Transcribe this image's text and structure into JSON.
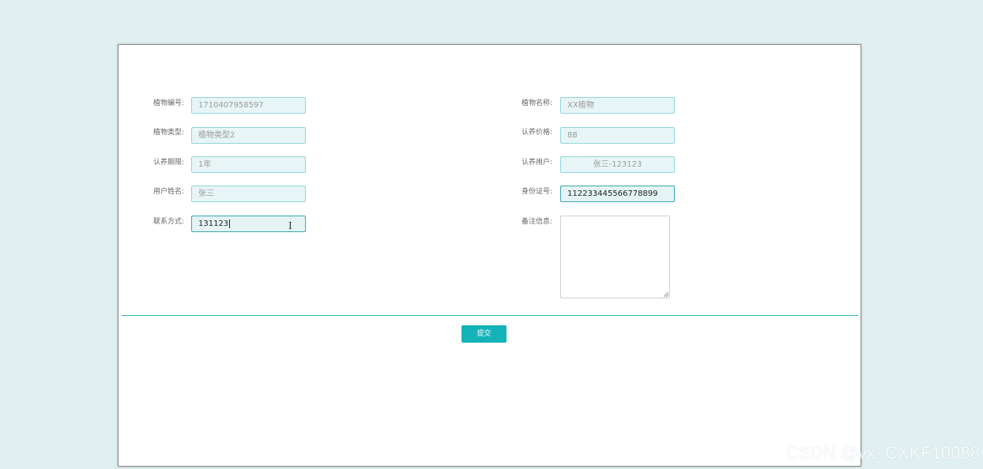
{
  "form": {
    "left": [
      {
        "label": "植物编号:",
        "value": "1710407958597"
      },
      {
        "label": "植物类型:",
        "value": "植物类型2"
      },
      {
        "label": "认养期限:",
        "value": "1年"
      },
      {
        "label": "用户姓名:",
        "value": "张三"
      },
      {
        "label": "联系方式:",
        "value": "131123"
      }
    ],
    "right": [
      {
        "label": "植物名称:",
        "value": "XX植物"
      },
      {
        "label": "认养价格:",
        "value": "88"
      },
      {
        "label": "认养用户:",
        "value": "张三-123123"
      },
      {
        "label": "身份证号:",
        "value": "112233445566778899"
      },
      {
        "label": "备注信息:",
        "value": ""
      }
    ]
  },
  "actions": {
    "submit_label": "提交"
  },
  "watermark": "CSDN @vx_CXKF10088",
  "colors": {
    "background": "#e0eff0",
    "accent": "#14b3b9",
    "input_border": "#8fd6da",
    "input_bg": "#e8f5f6"
  }
}
